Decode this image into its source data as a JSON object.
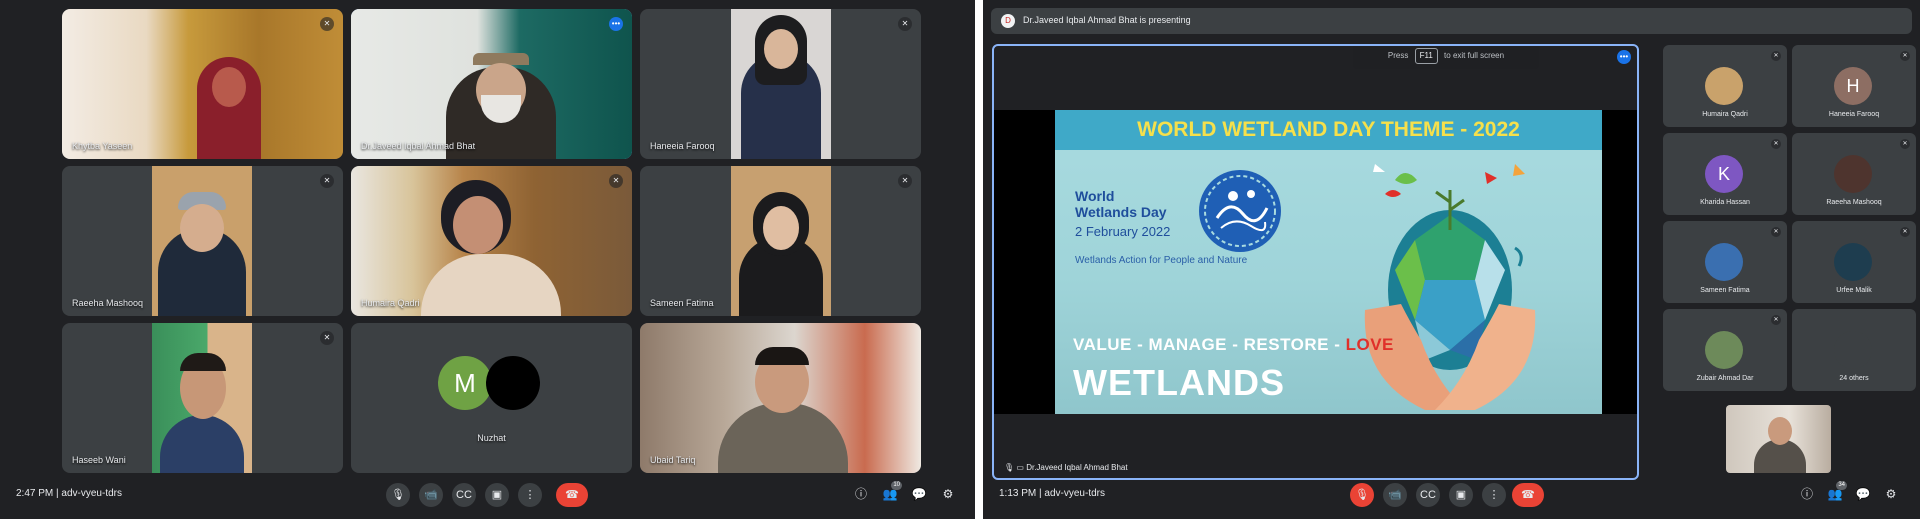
{
  "left_meeting": {
    "clock": "2:47 PM",
    "meeting_code": "adv-vyeu-tdrs",
    "participants": [
      {
        "name": "Khytba Yaseen"
      },
      {
        "name": "Dr.Javeed Iqbal Ahmad Bhat"
      },
      {
        "name": "Haneeia Farooq"
      },
      {
        "name": "Raeeha Mashooq"
      },
      {
        "name": "Humaira Qadri"
      },
      {
        "name": "Sameen Fatima"
      },
      {
        "name": "Haseeb Wani"
      },
      {
        "name": "Nuzhat"
      },
      {
        "name": "Ubaid Tariq"
      }
    ],
    "avatar_letter": "M",
    "controls": {
      "mic": "🎙",
      "camera": "📹",
      "captions": "CC",
      "present": "▣",
      "more": "⋮",
      "leave": "☎"
    },
    "right_icons": {
      "info": "ⓘ",
      "people": "👥",
      "people_count": "10",
      "chat": "💬",
      "activities": "⚙"
    }
  },
  "right_meeting": {
    "presenting_banner": "Dr.Javeed Iqbal Ahmad Bhat is presenting",
    "presenter_initial": "D",
    "toast": {
      "before": "Press",
      "key": "F11",
      "after": "to exit full screen"
    },
    "slide": {
      "title": "WORLD WETLAND DAY THEME - 2022",
      "logo_line1": "World",
      "logo_line2": "Wetlands Day",
      "date": "2 February 2022",
      "tagline": "Wetlands Action for People and Nature",
      "slogan_a": "VALUE - MANAGE - RESTORE - ",
      "slogan_love": "LOVE",
      "big_word": "WETLANDS"
    },
    "stage_footer": "Dr.Javeed Iqbal Ahmad Bhat",
    "participants": [
      {
        "name": "Humaira Qadri",
        "initial": "",
        "color": "#c9a26b"
      },
      {
        "name": "Haneeia Farooq",
        "initial": "H",
        "color": "#8d6e63"
      },
      {
        "name": "Kharida Hassan",
        "initial": "K",
        "color": "#7e57c2"
      },
      {
        "name": "Raeeha Mashooq",
        "initial": "",
        "color": "#4e342e"
      },
      {
        "name": "Sameen Fatima",
        "initial": "",
        "color": "#3a6fb0"
      },
      {
        "name": "Urfee Malik",
        "initial": "",
        "color": "#1e3d4f"
      },
      {
        "name": "Zubair Ahmad Dar",
        "initial": "",
        "color": "#6d8a5a"
      },
      {
        "name": "24 others",
        "initial": "",
        "color": "#3c4043"
      }
    ],
    "clock": "1:13 PM",
    "meeting_code": "adv-vyeu-tdrs",
    "controls": {
      "mic": "🎙",
      "camera": "📹",
      "captions": "CC",
      "present": "▣",
      "more": "⋮",
      "leave": "☎"
    },
    "right_icons": {
      "info": "ⓘ",
      "people": "👥",
      "people_count": "34",
      "chat": "💬",
      "activities": "⚙"
    }
  }
}
